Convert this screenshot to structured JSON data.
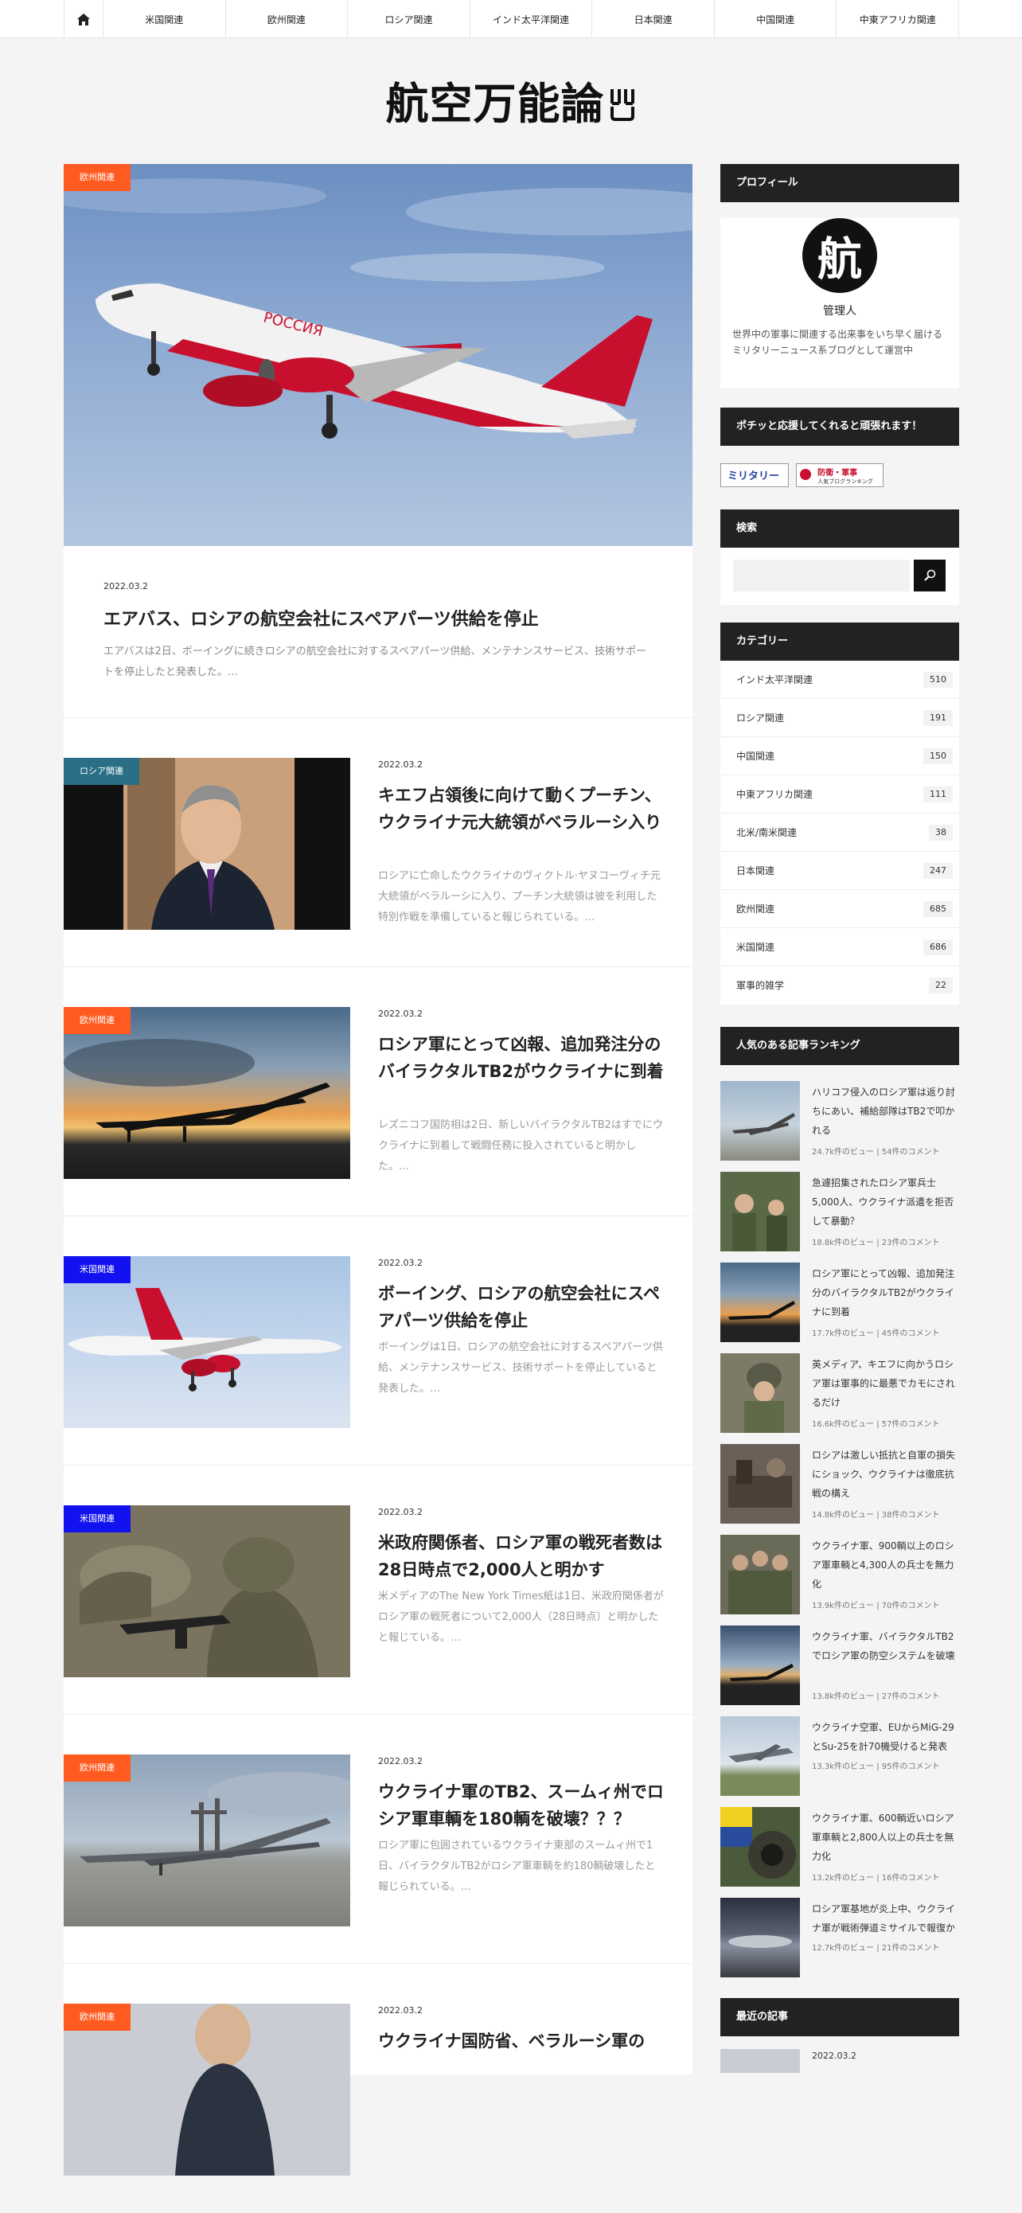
{
  "nav": {
    "items": [
      "米国関連",
      "欧州関連",
      "ロシア関連",
      "インド太平洋関連",
      "日本関連",
      "中国関連",
      "中東アフリカ関連"
    ]
  },
  "site": {
    "logo_text": "航空万能論"
  },
  "featured": {
    "category": "欧州関連",
    "date": "2022.03.2",
    "title": "エアバス、ロシアの航空会社にスペアパーツ供給を停止",
    "excerpt": "エアバスは2日、ボーイングに続きロシアの航空会社に対するスペアパーツ供給、メンテナンスサービス、技術サポートを停止したと発表した。…",
    "aircraft_text": "РОССИЯ"
  },
  "posts": [
    {
      "category": "ロシア関連",
      "date": "2022.03.2",
      "title": "キエフ占領後に向けて動くプーチン、ウクライナ元大統領がベラルーシ入り",
      "excerpt": "ロシアに亡命したウクライナのヴィクトル·ヤヌコーヴィチ元大統領がベラルーシに入り、プーチン大統領は彼を利用した特別作戦を準備していると報じられている。…"
    },
    {
      "category": "欧州関連",
      "date": "2022.03.2",
      "title": "ロシア軍にとって凶報、追加発注分のバイラクタルTB2がウクライナに到着",
      "excerpt": "レズニコフ国防相は2日、新しいバイラクタルTB2はすでにウクライナに到着して戦闘任務に投入されていると明かした。…"
    },
    {
      "category": "米国関連",
      "date": "2022.03.2",
      "title": "ボーイング、ロシアの航空会社にスペアパーツ供給を停止",
      "excerpt": "ボーイングは1日、ロシアの航空会社に対するスペアパーツ供給、メンテナンスサービス、技術サポートを停止していると発表した。…"
    },
    {
      "category": "米国関連",
      "date": "2022.03.2",
      "title": "米政府関係者、ロシア軍の戦死者数は28日時点で2,000人と明かす",
      "excerpt": "米メディアのThe New York Times紙は1日、米政府関係者がロシア軍の戦死者について2,000人（28日時点）と明かしたと報じている。…"
    },
    {
      "category": "欧州関連",
      "date": "2022.03.2",
      "title": "ウクライナ軍のTB2、スームィ州でロシア軍車輌を180輌を破壊？？？",
      "excerpt": "ロシア軍に包囲されているウクライナ東部のスームィ州で1日、バイラクタルTB2がロシア軍車輌を約180輌破壊したと報じられている。…"
    },
    {
      "category": "欧州関連",
      "date": "2022.03.2",
      "title": "ウクライナ国防省、ベラルーシ軍の",
      "excerpt": ""
    }
  ],
  "sidebar": {
    "profile": {
      "title": "プロフィール",
      "avatar_char": "航",
      "name": "管理人",
      "desc": "世界中の軍事に関連する出来事をいち早く届けるミリタリーニュース系ブログとして運営中"
    },
    "support": {
      "title": "ポチッと応援してくれると頑張れます！",
      "banner1": "ミリタリー",
      "banner2_line1": "防衛・軍事",
      "banner2_line2": "人気ブログランキング"
    },
    "search": {
      "title": "検索",
      "placeholder": ""
    },
    "categories": {
      "title": "カテゴリー",
      "items": [
        {
          "name": "インド太平洋関連",
          "count": "510"
        },
        {
          "name": "ロシア関連",
          "count": "191"
        },
        {
          "name": "中国関連",
          "count": "150"
        },
        {
          "name": "中東アフリカ関連",
          "count": "111"
        },
        {
          "name": "北米/南米関連",
          "count": "38"
        },
        {
          "name": "日本関連",
          "count": "247"
        },
        {
          "name": "欧州関連",
          "count": "685"
        },
        {
          "name": "米国関連",
          "count": "686"
        },
        {
          "name": "軍事的雑学",
          "count": "22"
        }
      ]
    },
    "ranking": {
      "title": "人気のある記事ランキング",
      "items": [
        {
          "title": "ハリコフ侵入のロシア軍は返り討ちにあい、補給部隊はTB2で叩かれる",
          "meta": "24.7k件のビュー | 54件のコメント"
        },
        {
          "title": "急遽招集されたロシア軍兵士5,000人、ウクライナ派遣を拒否して暴動？",
          "meta": "18.8k件のビュー | 23件のコメント"
        },
        {
          "title": "ロシア軍にとって凶報、追加発注分のバイラクタルTB2がウクライナに到着",
          "meta": "17.7k件のビュー | 45件のコメント"
        },
        {
          "title": "英メディア、キエフに向かうロシア軍は軍事的に最悪でカモにされるだけ",
          "meta": "16.6k件のビュー | 57件のコメント"
        },
        {
          "title": "ロシアは激しい抵抗と自軍の損失にショック、ウクライナは徹底抗戦の構え",
          "meta": "14.8k件のビュー | 38件のコメント"
        },
        {
          "title": "ウクライナ軍、900輌以上のロシア軍車輌と4,300人の兵士を無力化",
          "meta": "13.9k件のビュー | 70件のコメント"
        },
        {
          "title": "ウクライナ軍、バイラクタルTB2でロシア軍の防空システムを破壊",
          "meta": "13.8k件のビュー | 27件のコメント"
        },
        {
          "title": "ウクライナ空軍、EUからMiG-29とSu-25を計70機受けると発表",
          "meta": "13.3k件のビュー | 95件のコメント"
        },
        {
          "title": "ウクライナ軍、600輌近いロシア軍車輌と2,800人以上の兵士を無力化",
          "meta": "13.2k件のビュー | 16件のコメント"
        },
        {
          "title": "ロシア軍基地が炎上中、ウクライナ軍が戦術弾道ミサイルで報復か",
          "meta": "12.7k件のビュー | 21件のコメント"
        }
      ]
    },
    "recent": {
      "title": "最近の記事",
      "first_date": "2022.03.2"
    }
  }
}
